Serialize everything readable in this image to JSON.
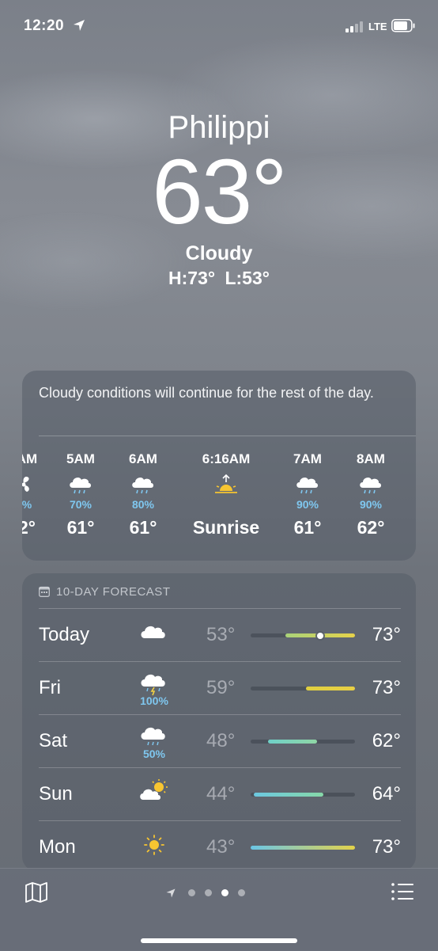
{
  "status_bar": {
    "time": "12:20",
    "network": "LTE"
  },
  "location": {
    "city": "Philippi",
    "temperature": "63°",
    "condition": "Cloudy",
    "high_low": "H:73° L:53°"
  },
  "hourly": {
    "summary": "Cloudy conditions will continue for the rest of the day.",
    "items": [
      {
        "time": "AM",
        "icon": "fan-icon",
        "precip": "%",
        "temp": "2°"
      },
      {
        "time": "5AM",
        "icon": "rain-cloud-icon",
        "precip": "70%",
        "temp": "61°"
      },
      {
        "time": "6AM",
        "icon": "rain-cloud-icon",
        "precip": "80%",
        "temp": "61°"
      },
      {
        "time": "6:16AM",
        "icon": "sunrise-icon",
        "precip": "",
        "temp": "Sunrise"
      },
      {
        "time": "7AM",
        "icon": "rain-cloud-icon",
        "precip": "90%",
        "temp": "61°"
      },
      {
        "time": "8AM",
        "icon": "rain-cloud-icon",
        "precip": "90%",
        "temp": "62°"
      }
    ]
  },
  "forecast": {
    "header": "10-DAY FORECAST",
    "range_min": 43,
    "range_max": 73,
    "days": [
      {
        "day": "Today",
        "icon": "cloud-icon",
        "precip": "",
        "low": "53°",
        "high": "73°",
        "low_val": 53,
        "high_val": 73,
        "current_val": 63,
        "colors": [
          "#a9d27a",
          "#e6d24a"
        ]
      },
      {
        "day": "Fri",
        "icon": "thunderstorm-icon",
        "precip": "100%",
        "low": "59°",
        "high": "73°",
        "low_val": 59,
        "high_val": 73,
        "colors": [
          "#e0d040",
          "#e8cf45"
        ]
      },
      {
        "day": "Sat",
        "icon": "rain-cloud-icon",
        "precip": "50%",
        "low": "48°",
        "high": "62°",
        "low_val": 48,
        "high_val": 62,
        "colors": [
          "#6fd0c8",
          "#8fd6a5"
        ]
      },
      {
        "day": "Sun",
        "icon": "partly-sunny-icon",
        "precip": "",
        "low": "44°",
        "high": "64°",
        "low_val": 44,
        "high_val": 64,
        "colors": [
          "#6cc8e0",
          "#86d8a8"
        ]
      },
      {
        "day": "Mon",
        "icon": "sun-icon",
        "precip": "",
        "low": "43°",
        "high": "73°",
        "low_val": 43,
        "high_val": 73,
        "colors": [
          "#6bc6e6",
          "#e3d24a"
        ]
      }
    ]
  },
  "bottom_bar": {
    "page_count": 4,
    "active_page": 2
  }
}
